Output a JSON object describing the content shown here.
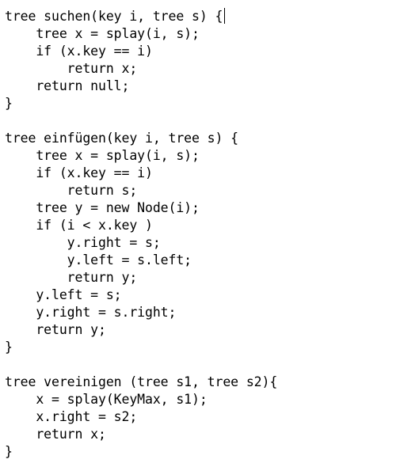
{
  "editor": {
    "lines": [
      "tree suchen(key i, tree s) {",
      "    tree x = splay(i, s);",
      "    if (x.key == i)",
      "        return x;",
      "    return null;",
      "}",
      "",
      "tree einfügen(key i, tree s) {",
      "    tree x = splay(i, s);",
      "    if (x.key == i)",
      "        return s;",
      "    tree y = new Node(i);",
      "    if (i < x.key )",
      "        y.right = s;",
      "        y.left = s.left;",
      "        return y;",
      "    y.left = s;",
      "    y.right = s.right;",
      "    return y;",
      "}",
      "",
      "tree vereinigen (tree s1, tree s2){",
      "    x = splay(KeyMax, s1);",
      "    x.right = s2;",
      "    return x;",
      "}"
    ]
  }
}
